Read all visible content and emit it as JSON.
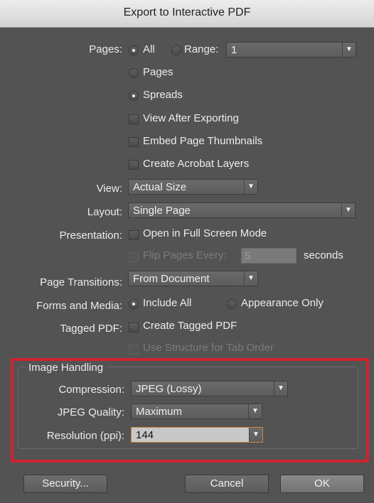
{
  "window": {
    "title": "Export to Interactive PDF"
  },
  "pages": {
    "label": "Pages:",
    "all": "All",
    "range": "Range:",
    "range_value": "1",
    "opt_pages": "Pages",
    "opt_spreads": "Spreads"
  },
  "options": {
    "view_after": "View After Exporting",
    "embed_thumbs": "Embed Page Thumbnails",
    "acrobat_layers": "Create Acrobat Layers"
  },
  "view": {
    "label": "View:",
    "value": "Actual Size"
  },
  "layout": {
    "label": "Layout:",
    "value": "Single Page"
  },
  "presentation": {
    "label": "Presentation:",
    "full_screen": "Open in Full Screen Mode",
    "flip": "Flip Pages Every:",
    "flip_value": "5",
    "seconds": "seconds"
  },
  "transitions": {
    "label": "Page Transitions:",
    "value": "From Document"
  },
  "forms": {
    "label": "Forms and Media:",
    "include_all": "Include All",
    "appearance_only": "Appearance Only"
  },
  "tagged": {
    "label": "Tagged PDF:",
    "create_tagged": "Create Tagged PDF",
    "use_structure": "Use Structure for Tab Order"
  },
  "image_handling": {
    "title": "Image Handling",
    "compression_label": "Compression:",
    "compression": "JPEG (Lossy)",
    "quality_label": "JPEG Quality:",
    "quality": "Maximum",
    "resolution_label": "Resolution (ppi):",
    "resolution": "144"
  },
  "buttons": {
    "security": "Security...",
    "cancel": "Cancel",
    "ok": "OK"
  }
}
